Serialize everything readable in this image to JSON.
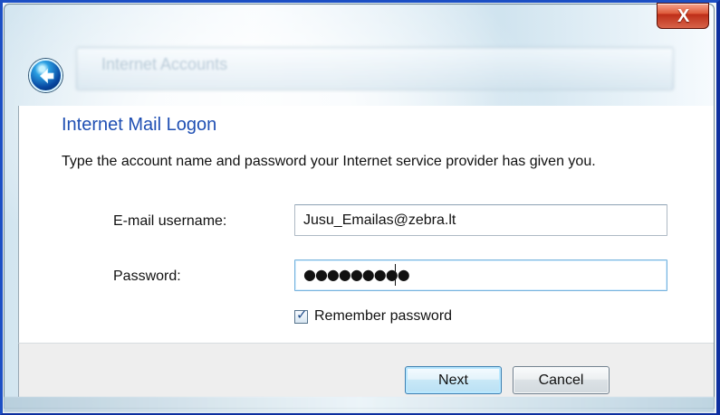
{
  "window": {
    "background_title": "Internet Accounts",
    "close_label": "X"
  },
  "icons": {
    "back": "back-arrow-icon",
    "close": "close-icon",
    "check": "check-icon"
  },
  "dialog": {
    "title": "Internet Mail Logon",
    "instruction": "Type the account name and password your Internet service provider has given you."
  },
  "form": {
    "email_label": "E-mail username:",
    "email_value": "Jusu_Emailas@zebra.lt",
    "password_label": "Password:",
    "password_mask": "●●●●●●●●●",
    "remember_label": "Remember password",
    "remember_checked": true
  },
  "buttons": {
    "next": "Next",
    "cancel": "Cancel"
  },
  "colors": {
    "title_blue": "#1f4fb3",
    "window_blue": "#1c4fc4",
    "close_red": "#dd5737",
    "focused_field": "#76b2dc"
  }
}
